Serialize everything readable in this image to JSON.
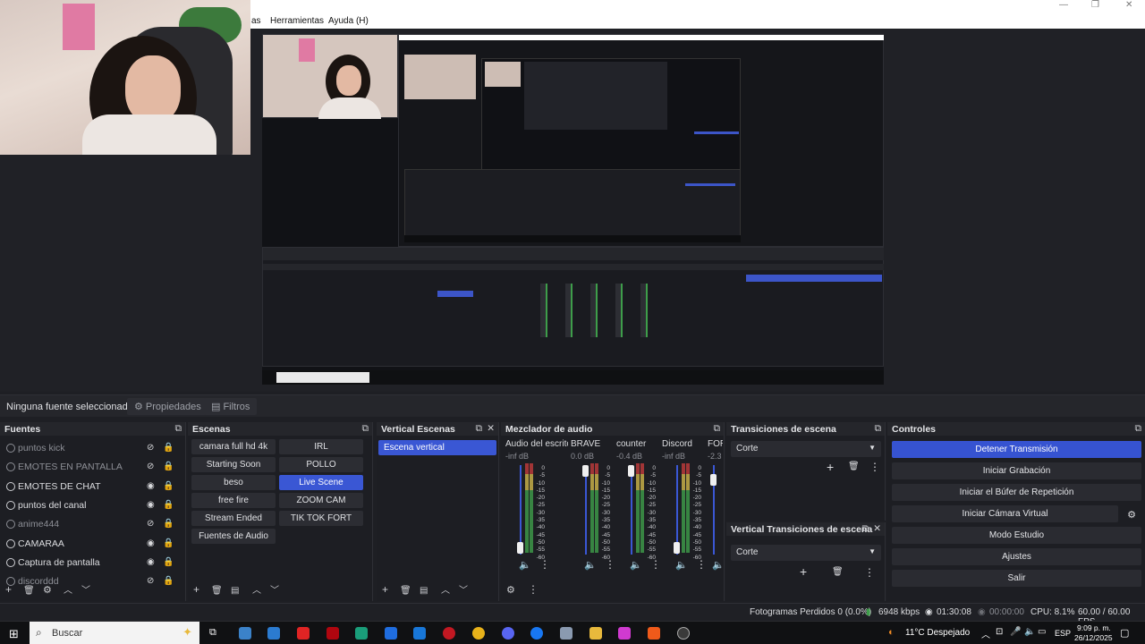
{
  "menu": {
    "partial": "as",
    "herramientas": "Herramientas",
    "ayuda": "Ayuda (H)"
  },
  "sourcebar": {
    "no_source": "Ninguna fuente seleccionad",
    "properties": "Propiedades",
    "filters": "Filtros"
  },
  "sources": {
    "title": "Fuentes",
    "items": [
      {
        "label": "puntos kick",
        "dim": true
      },
      {
        "label": "EMOTES EN PANTALLA",
        "dim": true
      },
      {
        "label": "EMOTES DE CHAT",
        "dim": false
      },
      {
        "label": "puntos del canal",
        "dim": false
      },
      {
        "label": "anime444",
        "dim": true
      },
      {
        "label": "CAMARAA",
        "dim": false
      },
      {
        "label": "Captura de pantalla",
        "dim": false
      },
      {
        "label": "discorddd",
        "dim": true
      }
    ]
  },
  "scenes": {
    "title": "Escenas",
    "left": [
      "camara full hd 4k",
      "Starting Soon",
      "beso",
      "free fire",
      "Stream Ended",
      "Fuentes de Audio"
    ],
    "right": [
      "IRL",
      "POLLO",
      "Live Scene",
      "ZOOM CAM",
      "TIK TOK FORT"
    ],
    "selected": "Live Scene"
  },
  "vertical_scenes": {
    "title": "Vertical Escenas",
    "items": [
      "Escena vertical"
    ]
  },
  "mixer": {
    "title": "Mezclador de audio",
    "channels": [
      {
        "name": "Audio del escrito",
        "db": "-inf dB"
      },
      {
        "name": "BRAVE",
        "db": "0.0 dB"
      },
      {
        "name": "counter",
        "db": "-0.4 dB"
      },
      {
        "name": "Discord",
        "db": "-inf dB"
      },
      {
        "name": "FOR",
        "db": "-2.3"
      }
    ],
    "scale": [
      "0",
      "-5",
      "-10",
      "-15",
      "-20",
      "-25",
      "-30",
      "-35",
      "-40",
      "-45",
      "-50",
      "-55",
      "-60"
    ]
  },
  "transitions": {
    "title": "Transiciones de escena",
    "value": "Corte"
  },
  "vertical_transitions": {
    "title": "Vertical Transiciones de escena",
    "value": "Corte"
  },
  "controls": {
    "title": "Controles",
    "buttons": [
      "Detener Transmisión",
      "Iniciar Grabación",
      "Iniciar el Búfer de Repetición",
      "Iniciar Cámara Virtual",
      "Modo Estudio",
      "Ajustes",
      "Salir"
    ]
  },
  "status": {
    "dropped": "Fotogramas Perdidos 0 (0.0%)",
    "kbps": "6948 kbps",
    "stream_time": "01:30:08",
    "rec_time": "00:00:00",
    "cpu": "CPU: 8.1%",
    "fps": "60.00 / 60.00 FPS"
  },
  "taskbar": {
    "search": "Buscar",
    "weather": "11°C  Despejado",
    "lang": "ESP",
    "time": "9:09 p. m.",
    "date": "26/12/2025"
  },
  "colors": {
    "accent": "#3a57d4",
    "bg": "#1d1e23"
  }
}
